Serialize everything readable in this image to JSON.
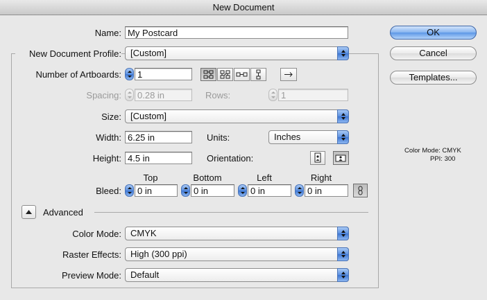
{
  "window": {
    "title": "New Document"
  },
  "name": {
    "label": "Name:",
    "value": "My Postcard"
  },
  "profile": {
    "label": "New Document Profile:",
    "value": "[Custom]"
  },
  "artboards": {
    "label": "Number of Artboards:",
    "value": "1"
  },
  "spacing": {
    "label": "Spacing:",
    "value": "0.28 in"
  },
  "rows": {
    "label": "Rows:",
    "value": "1"
  },
  "size": {
    "label": "Size:",
    "value": "[Custom]"
  },
  "width": {
    "label": "Width:",
    "value": "6.25 in"
  },
  "units": {
    "label": "Units:",
    "value": "Inches"
  },
  "height": {
    "label": "Height:",
    "value": "4.5 in"
  },
  "orientation": {
    "label": "Orientation:"
  },
  "bleed": {
    "label": "Bleed:",
    "top": {
      "label": "Top",
      "value": "0 in"
    },
    "bottom": {
      "label": "Bottom",
      "value": "0 in"
    },
    "left": {
      "label": "Left",
      "value": "0 in"
    },
    "right": {
      "label": "Right",
      "value": "0 in"
    }
  },
  "advanced": {
    "label": "Advanced"
  },
  "color_mode": {
    "label": "Color Mode:",
    "value": "CMYK"
  },
  "raster_effects": {
    "label": "Raster Effects:",
    "value": "High (300 ppi)"
  },
  "preview_mode": {
    "label": "Preview Mode:",
    "value": "Default"
  },
  "buttons": {
    "ok": "OK",
    "cancel": "Cancel",
    "templates": "Templates..."
  },
  "summary": {
    "color_mode": "Color Mode: CMYK",
    "ppi": "PPI: 300"
  },
  "colors": {
    "accent": "#5c97e6",
    "background": "#e8e8e8"
  }
}
